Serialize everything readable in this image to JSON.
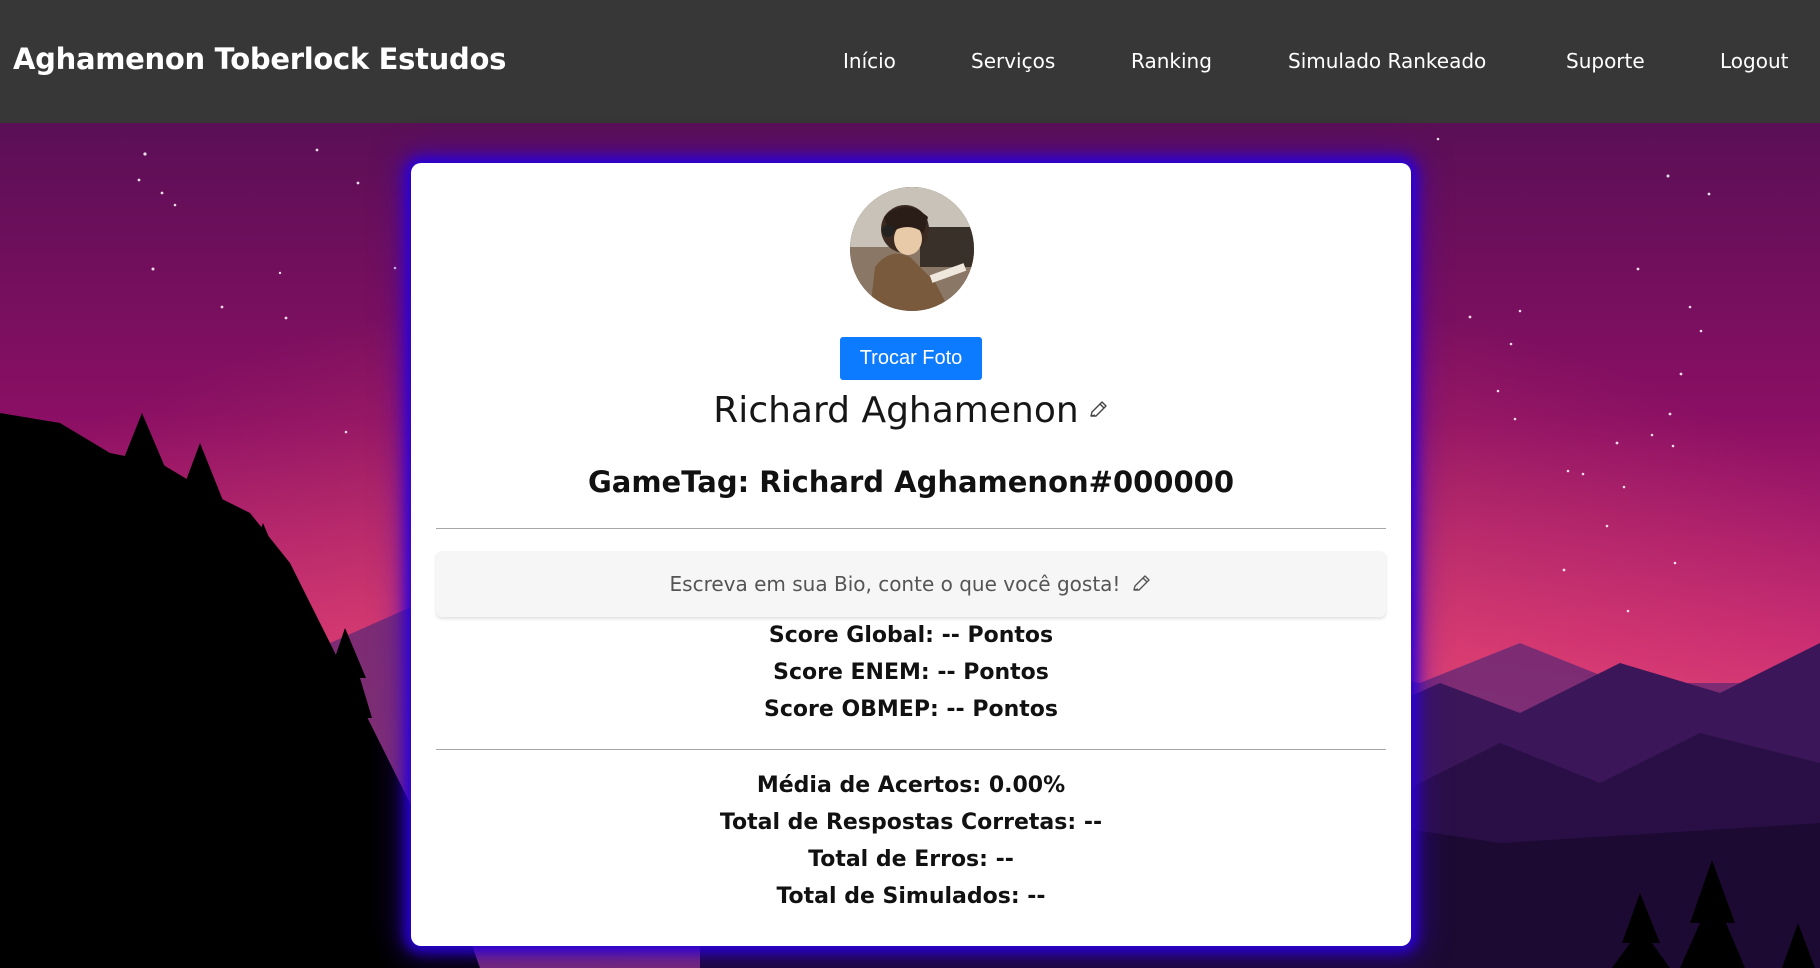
{
  "header": {
    "brand": "Aghamenon Toberlock Estudos",
    "nav": [
      "Início",
      "Serviços",
      "Ranking",
      "Simulado Rankeado",
      "Suporte",
      "Logout"
    ]
  },
  "profile": {
    "change_photo_label": "Trocar Foto",
    "name": "Richard Aghamenon",
    "gametag": "GameTag: Richard Aghamenon#000000",
    "bio_placeholder": "Escreva em sua Bio, conte o que você gosta!",
    "scores": [
      "Score Global: -- Pontos",
      "Score ENEM: -- Pontos",
      "Score OBMEP: -- Pontos"
    ],
    "stats": [
      "Média de Acertos: 0.00%",
      "Total de Respostas Corretas: --",
      "Total de Erros: --",
      "Total de Simulados: --"
    ]
  },
  "icons": {
    "edit_name": "pencil-icon",
    "edit_bio": "pencil-icon"
  },
  "colors": {
    "header_bg": "#373737",
    "button_primary": "#0d7bff",
    "card_glow": "#2800dc"
  }
}
